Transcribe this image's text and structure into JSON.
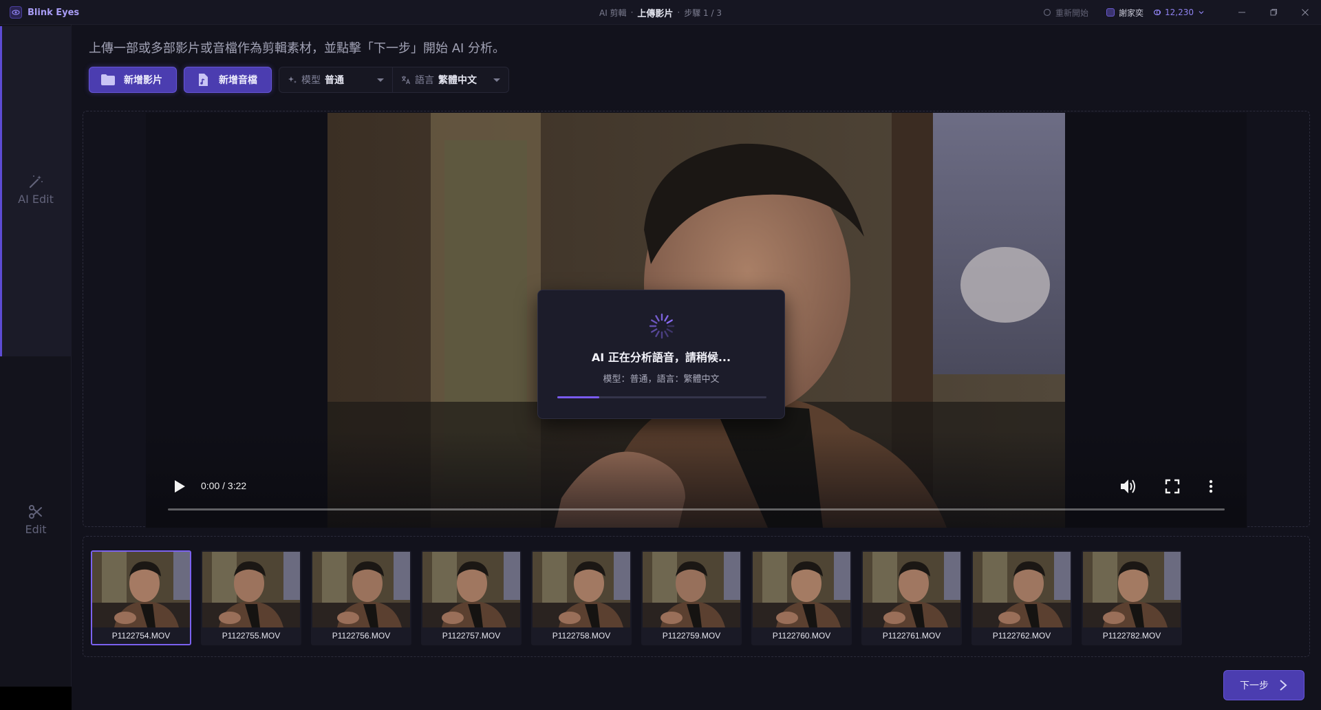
{
  "app": {
    "name": "Blink Eyes",
    "brand_color": "#a89cf5",
    "accent": "#5d4bd4"
  },
  "titlebar": {
    "section": "AI 剪輯",
    "separator": "·",
    "current": "上傳影片",
    "step": "步驟 1 / 3",
    "restart_label": "重新開始",
    "user_name": "謝家奕",
    "credits": "12,230"
  },
  "sidebar": {
    "items": [
      {
        "label": "AI Edit",
        "icon": "magic-wand-icon",
        "active": true
      },
      {
        "label": "Edit",
        "icon": "scissors-icon",
        "active": false
      }
    ]
  },
  "main": {
    "instruction": "上傳一部或多部影片或音檔作為剪輯素材，並點擊「下一步」開始 AI 分析。",
    "add_video_label": "新增影片",
    "add_audio_label": "新增音檔",
    "model_label": "模型",
    "model_value": "普通",
    "language_label": "語言",
    "language_value": "繁體中文"
  },
  "player": {
    "time": "0:00 / 3:22",
    "progress": 0
  },
  "overlay": {
    "title": "AI 正在分析語音，請稍候...",
    "subtitle": "模型：普通，語言：繁體中文",
    "progress": 0.2
  },
  "thumbnails": [
    {
      "name": "P1122754.MOV",
      "selected": true
    },
    {
      "name": "P1122755.MOV",
      "selected": false
    },
    {
      "name": "P1122756.MOV",
      "selected": false
    },
    {
      "name": "P1122757.MOV",
      "selected": false
    },
    {
      "name": "P1122758.MOV",
      "selected": false
    },
    {
      "name": "P1122759.MOV",
      "selected": false
    },
    {
      "name": "P1122760.MOV",
      "selected": false
    },
    {
      "name": "P1122761.MOV",
      "selected": false
    },
    {
      "name": "P1122762.MOV",
      "selected": false
    },
    {
      "name": "P1122782.MOV",
      "selected": false
    }
  ],
  "footer": {
    "next_label": "下一步"
  }
}
